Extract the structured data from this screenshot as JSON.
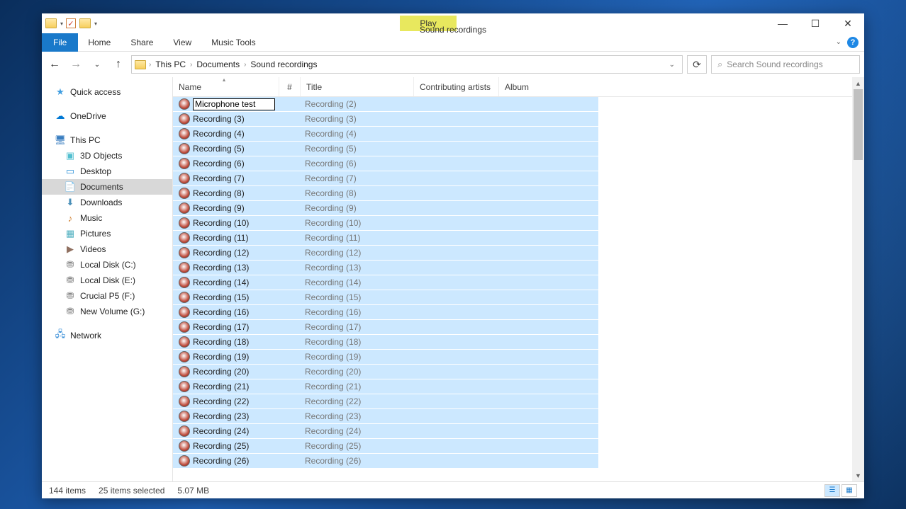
{
  "window": {
    "title": "Sound recordings",
    "play_tab": "Play"
  },
  "ribbon": {
    "file": "File",
    "home": "Home",
    "share": "Share",
    "view": "View",
    "music_tools": "Music Tools"
  },
  "breadcrumb": {
    "root": "This PC",
    "l1": "Documents",
    "l2": "Sound recordings"
  },
  "search": {
    "placeholder": "Search Sound recordings"
  },
  "nav": {
    "quick_access": "Quick access",
    "onedrive": "OneDrive",
    "this_pc": "This PC",
    "objects3d": "3D Objects",
    "desktop": "Desktop",
    "documents": "Documents",
    "downloads": "Downloads",
    "music": "Music",
    "pictures": "Pictures",
    "videos": "Videos",
    "disk_c": "Local Disk (C:)",
    "disk_e": "Local Disk (E:)",
    "disk_f": "Crucial P5 (F:)",
    "disk_g": "New Volume (G:)",
    "network": "Network"
  },
  "columns": {
    "name": "Name",
    "num": "#",
    "title": "Title",
    "artist": "Contributing artists",
    "album": "Album"
  },
  "rename_value": "Microphone test",
  "files": [
    {
      "name": "Microphone test",
      "title": "Recording (2)",
      "editing": true
    },
    {
      "name": "Recording (3)",
      "title": "Recording (3)"
    },
    {
      "name": "Recording (4)",
      "title": "Recording (4)"
    },
    {
      "name": "Recording (5)",
      "title": "Recording (5)"
    },
    {
      "name": "Recording (6)",
      "title": "Recording (6)"
    },
    {
      "name": "Recording (7)",
      "title": "Recording (7)"
    },
    {
      "name": "Recording (8)",
      "title": "Recording (8)"
    },
    {
      "name": "Recording (9)",
      "title": "Recording (9)"
    },
    {
      "name": "Recording (10)",
      "title": "Recording (10)"
    },
    {
      "name": "Recording (11)",
      "title": "Recording (11)"
    },
    {
      "name": "Recording (12)",
      "title": "Recording (12)"
    },
    {
      "name": "Recording (13)",
      "title": "Recording (13)"
    },
    {
      "name": "Recording (14)",
      "title": "Recording (14)"
    },
    {
      "name": "Recording (15)",
      "title": "Recording (15)"
    },
    {
      "name": "Recording (16)",
      "title": "Recording (16)"
    },
    {
      "name": "Recording (17)",
      "title": "Recording (17)"
    },
    {
      "name": "Recording (18)",
      "title": "Recording (18)"
    },
    {
      "name": "Recording (19)",
      "title": "Recording (19)"
    },
    {
      "name": "Recording (20)",
      "title": "Recording (20)"
    },
    {
      "name": "Recording (21)",
      "title": "Recording (21)"
    },
    {
      "name": "Recording (22)",
      "title": "Recording (22)"
    },
    {
      "name": "Recording (23)",
      "title": "Recording (23)"
    },
    {
      "name": "Recording (24)",
      "title": "Recording (24)"
    },
    {
      "name": "Recording (25)",
      "title": "Recording (25)"
    },
    {
      "name": "Recording (26)",
      "title": "Recording (26)"
    }
  ],
  "status": {
    "items": "144 items",
    "selected": "25 items selected",
    "size": "5.07 MB"
  }
}
